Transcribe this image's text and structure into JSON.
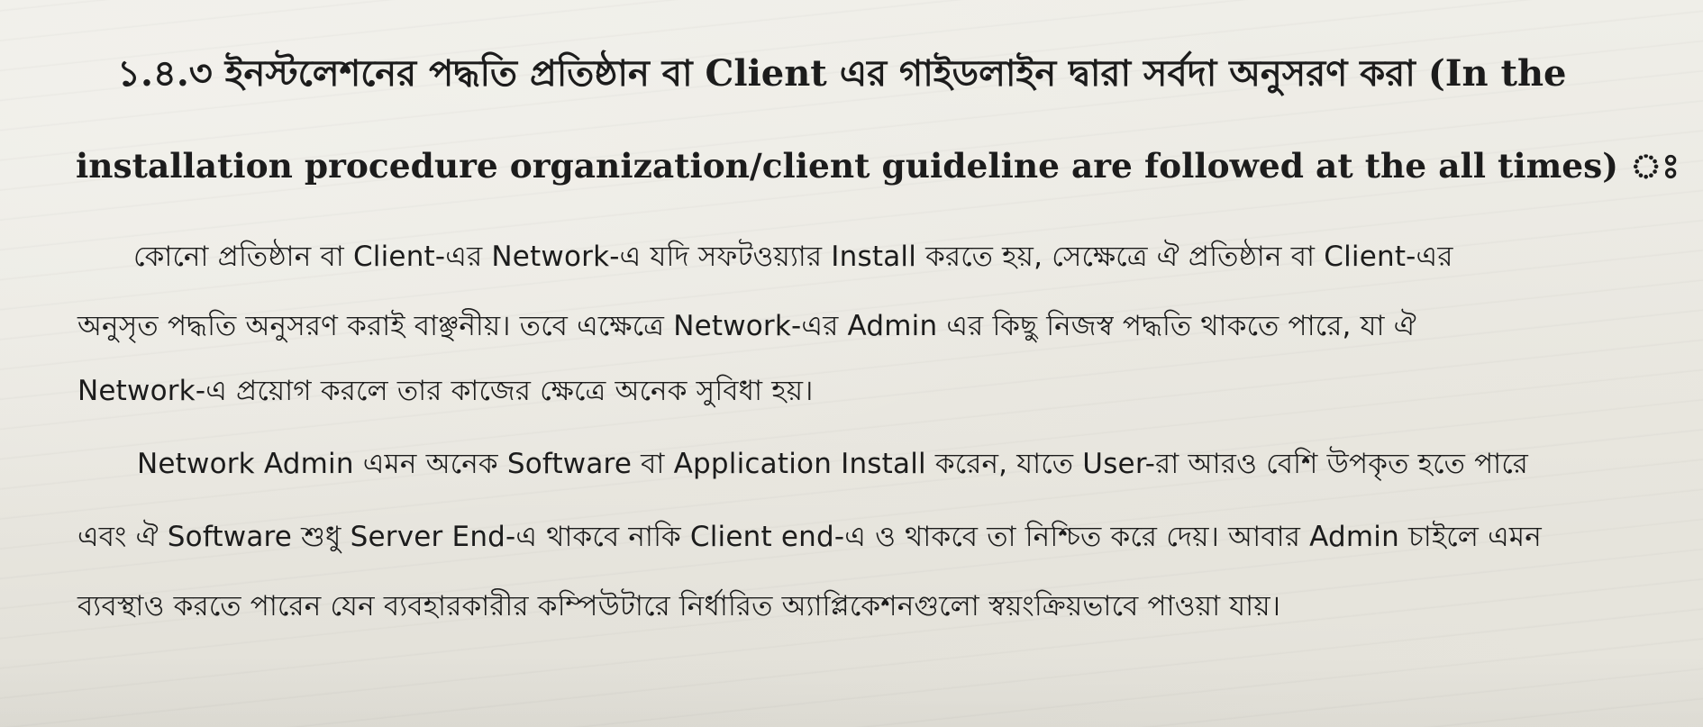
{
  "heading": {
    "line1": "১.৪.৩ ইনস্টলেশনের পদ্ধতি প্রতিষ্ঠান বা Client এর গাইডলাইন দ্বারা সর্বদা অনুসরণ করা (In the",
    "line2": "installation procedure organization/client guideline are followed at the all times) ঃ"
  },
  "paragraphs": [
    {
      "lines": [
        "কোনো প্রতিষ্ঠান বা Client-এর Network-এ যদি সফটওয়্যার Install করতে হয়, সেক্ষেত্রে ঐ প্রতিষ্ঠান বা Client-এর",
        "অনুসৃত পদ্ধতি অনুসরণ করাই বাঞ্ছনীয়। তবে এক্ষেত্রে Network-এর Admin এর কিছু নিজস্ব পদ্ধতি থাকতে পারে, যা ঐ",
        "Network-এ প্রয়োগ করলে তার কাজের ক্ষেত্রে অনেক সুবিধা হয়।"
      ]
    },
    {
      "lines": [
        "Network Admin এমন অনেক Software বা Application Install করেন, যাতে User-রা আরও বেশি উপকৃত হতে পারে",
        "এবং ঐ Software শুধু Server End-এ থাকবে নাকি Client end-এ ও থাকবে তা নিশ্চিত করে দেয়। আবার Admin চাইলে এমন",
        "ব্যবস্থাও করতে পারেন যেন ব্যবহারকারীর কম্পিউটারে নির্ধারিত অ্যাপ্লিকেশনগুলো স্বয়ংক্রিয়ভাবে পাওয়া যায়।"
      ]
    }
  ]
}
